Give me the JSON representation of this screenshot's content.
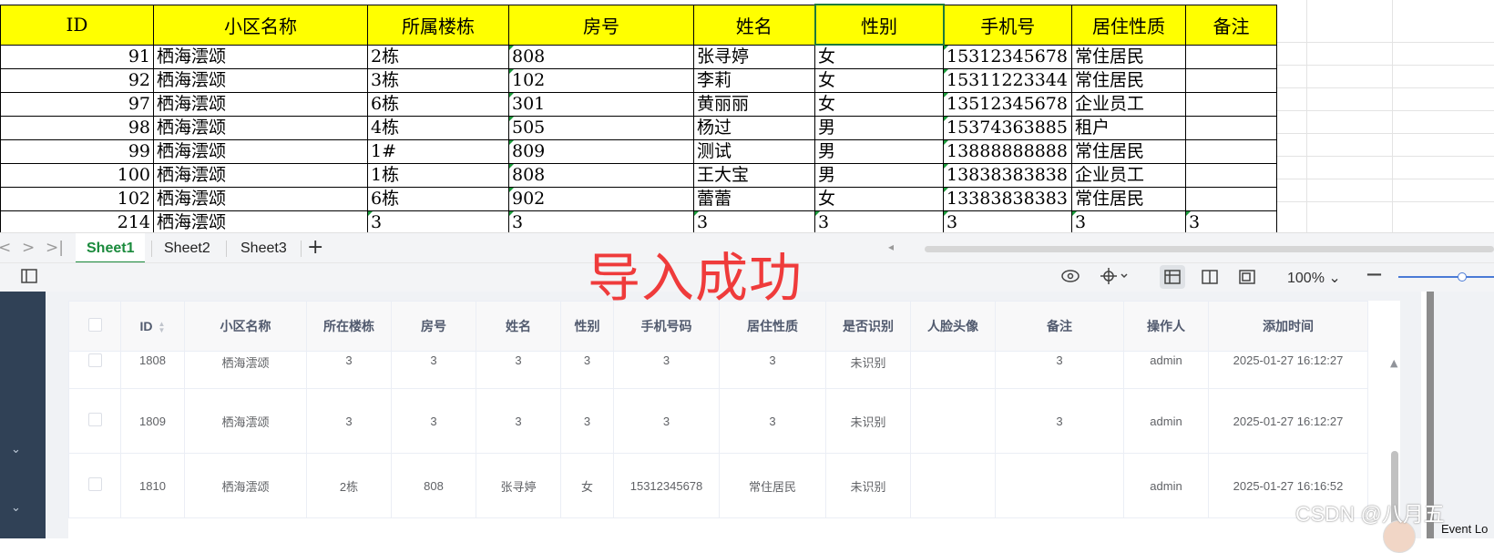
{
  "sheet": {
    "headers": [
      "ID",
      "小区名称",
      "所属楼栋",
      "房号",
      "姓名",
      "性别",
      "手机号",
      "居住性质",
      "备注"
    ],
    "rows": [
      [
        "91",
        "栖海澐颂",
        "2栋",
        "808",
        "张寻婷",
        "女",
        "15312345678",
        "常住居民",
        ""
      ],
      [
        "92",
        "栖海澐颂",
        "3栋",
        "102",
        "李莉",
        "女",
        "15311223344",
        "常住居民",
        ""
      ],
      [
        "97",
        "栖海澐颂",
        "6栋",
        "301",
        "黄丽丽",
        "女",
        "13512345678",
        "企业员工",
        ""
      ],
      [
        "98",
        "栖海澐颂",
        "4栋",
        "505",
        "杨过",
        "男",
        "15374363885",
        "租户",
        ""
      ],
      [
        "99",
        "栖海澐颂",
        "1#",
        "809",
        "测试",
        "男",
        "13888888888",
        "常住居民",
        ""
      ],
      [
        "100",
        "栖海澐颂",
        "1栋",
        "808",
        "王大宝",
        "男",
        "13838383838",
        "企业员工",
        ""
      ],
      [
        "102",
        "栖海澐颂",
        "6栋",
        "902",
        "蕾蕾",
        "女",
        "13383838383",
        "常住居民",
        ""
      ],
      [
        "214",
        "栖海澐颂",
        "3",
        "3",
        "3",
        "3",
        "3",
        "3",
        "3"
      ]
    ]
  },
  "tabs": [
    "Sheet1",
    "Sheet2",
    "Sheet3"
  ],
  "tab_nav": {
    "first": "|<",
    "prev": "<",
    "next": ">",
    "last": ">|",
    "add": "+"
  },
  "statusbar": {
    "zoom": "100%",
    "zoom_caret": "⌄",
    "minus": "—"
  },
  "overlay_text": "导入成功",
  "grid": {
    "headers": [
      "ID",
      "小区名称",
      "所在楼栋",
      "房号",
      "姓名",
      "性别",
      "手机号码",
      "居住性质",
      "是否识别",
      "人脸头像",
      "备注",
      "操作人",
      "添加时间"
    ],
    "rows": [
      [
        "1808",
        "栖海澐颂",
        "3",
        "3",
        "3",
        "3",
        "3",
        "3",
        "未识别",
        "",
        "3",
        "admin",
        "2025-01-27 16:12:27"
      ],
      [
        "1809",
        "栖海澐颂",
        "3",
        "3",
        "3",
        "3",
        "3",
        "3",
        "未识别",
        "",
        "3",
        "admin",
        "2025-01-27 16:12:27"
      ],
      [
        "1810",
        "栖海澐颂",
        "2栋",
        "808",
        "张寻婷",
        "女",
        "15312345678",
        "常住居民",
        "未识别",
        "",
        "",
        "admin",
        "2025-01-27 16:16:52"
      ]
    ]
  },
  "watermark": "CSDN @八月五",
  "event_log": "Event Lo"
}
